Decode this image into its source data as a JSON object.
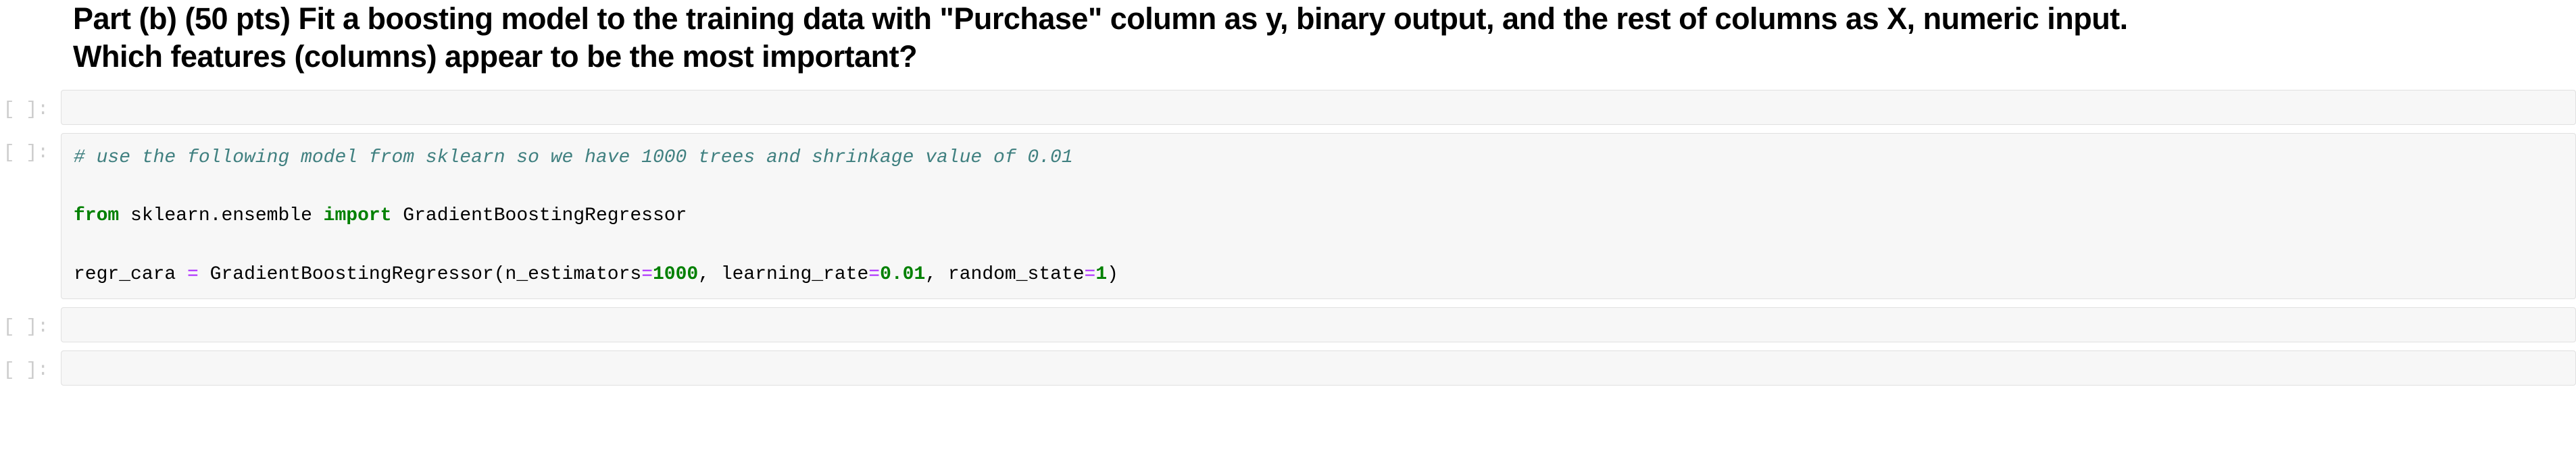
{
  "heading": {
    "line1": "Part (b) (50 pts) Fit a boosting model to the training data with \"Purchase\" column as y, binary output, and the rest of columns as X, numeric input.",
    "line2": "Which features (columns) appear to be the most important?"
  },
  "prompts": {
    "cell1": "[ ]:",
    "cell2": "[ ]:",
    "cell3": "[ ]:",
    "cell4": "[ ]:"
  },
  "code": {
    "comment": "# use the following model from sklearn so we have 1000 trees and shrinkage value of 0.01",
    "import_from": "from",
    "import_module": " sklearn.ensemble ",
    "import_kw": "import",
    "import_name": " GradientBoostingRegressor",
    "assign_var": "regr_cara ",
    "assign_eq": "=",
    "assign_sp": " ",
    "class_name": "GradientBoostingRegressor",
    "open_paren": "(",
    "param1_name": "n_estimators",
    "param1_eq": "=",
    "param1_val": "1000",
    "comma1": ", ",
    "param2_name": "learning_rate",
    "param2_eq": "=",
    "param2_val": "0.01",
    "comma2": ", ",
    "param3_name": "random_state",
    "param3_eq": "=",
    "param3_val": "1",
    "close_paren": ")"
  },
  "chart_data": {
    "type": "table",
    "title": "Jupyter Notebook Code Cells",
    "cells": [
      {
        "prompt": "[ ]:",
        "content": "",
        "type": "code",
        "empty": true
      },
      {
        "prompt": "[ ]:",
        "content": "# use the following model from sklearn so we have 1000 trees and shrinkage value of 0.01\n\nfrom sklearn.ensemble import GradientBoostingRegressor\n\nregr_cara = GradientBoostingRegressor(n_estimators=1000, learning_rate=0.01, random_state=1)",
        "type": "code",
        "empty": false
      },
      {
        "prompt": "[ ]:",
        "content": "",
        "type": "code",
        "empty": true
      },
      {
        "prompt": "[ ]:",
        "content": "",
        "type": "code",
        "empty": true
      }
    ]
  }
}
